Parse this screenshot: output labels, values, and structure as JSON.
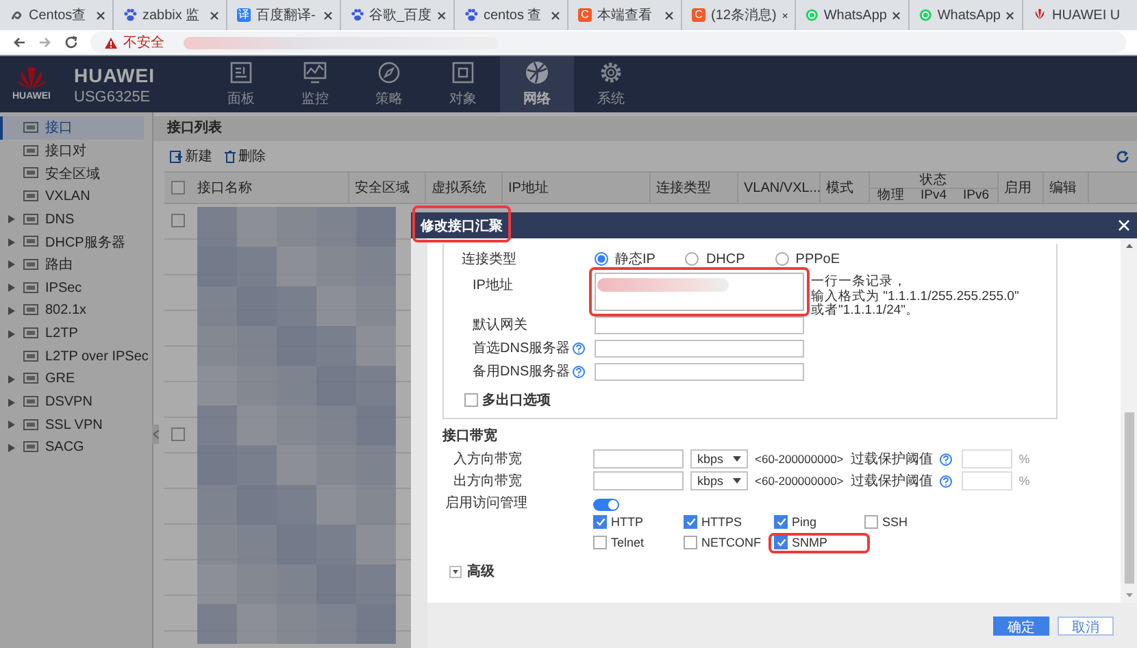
{
  "browser": {
    "tabs": [
      {
        "title": "Centos查",
        "kind": "swirl"
      },
      {
        "title": "zabbix 监",
        "kind": "paw"
      },
      {
        "title": "百度翻译-",
        "kind": "badge",
        "badge": "译",
        "color": "#2f7ef5"
      },
      {
        "title": "谷歌_百度",
        "kind": "paw"
      },
      {
        "title": "centos 查",
        "kind": "paw"
      },
      {
        "title": "本端查看",
        "kind": "badge",
        "badge": "C",
        "color": "#f25a2a"
      },
      {
        "title": "(12条消息)",
        "kind": "badge",
        "badge": "C",
        "color": "#f25a2a"
      },
      {
        "title": "WhatsApp",
        "kind": "whatsapp"
      },
      {
        "title": "WhatsApp",
        "kind": "whatsapp"
      },
      {
        "title": "HUAWEI U",
        "kind": "huawei"
      }
    ],
    "address": {
      "security_label": "不安全",
      "url_redacted": true
    }
  },
  "app": {
    "logo_text": "HUAWEI",
    "brand": "HUAWEI",
    "model": "USG6325E",
    "nav": [
      {
        "label": "面板",
        "kind": "dashboard",
        "selected": false
      },
      {
        "label": "监控",
        "kind": "monitor",
        "selected": false
      },
      {
        "label": "策略",
        "kind": "compass",
        "selected": false
      },
      {
        "label": "对象",
        "kind": "object",
        "selected": false
      },
      {
        "label": "网络",
        "kind": "globe",
        "selected": true
      },
      {
        "label": "系统",
        "kind": "gear",
        "selected": false
      }
    ]
  },
  "sidebar": {
    "items": [
      {
        "label": "接口",
        "selected": true,
        "expandable": false
      },
      {
        "label": "接口对",
        "selected": false,
        "expandable": false
      },
      {
        "label": "安全区域",
        "selected": false,
        "expandable": false
      },
      {
        "label": "VXLAN",
        "selected": false,
        "expandable": false
      },
      {
        "label": "DNS",
        "selected": false,
        "expandable": true
      },
      {
        "label": "DHCP服务器",
        "selected": false,
        "expandable": true
      },
      {
        "label": "路由",
        "selected": false,
        "expandable": true
      },
      {
        "label": "IPSec",
        "selected": false,
        "expandable": true
      },
      {
        "label": "802.1x",
        "selected": false,
        "expandable": true
      },
      {
        "label": "L2TP",
        "selected": false,
        "expandable": true
      },
      {
        "label": "L2TP over IPSec",
        "selected": false,
        "expandable": false
      },
      {
        "label": "GRE",
        "selected": false,
        "expandable": true
      },
      {
        "label": "DSVPN",
        "selected": false,
        "expandable": true
      },
      {
        "label": "SSL VPN",
        "selected": false,
        "expandable": true
      },
      {
        "label": "SACG",
        "selected": false,
        "expandable": true
      }
    ]
  },
  "panel": {
    "title": "接口列表",
    "toolbar": [
      {
        "label": "新建",
        "kind": "new"
      },
      {
        "label": "删除",
        "kind": "delete"
      }
    ],
    "columns": [
      "接口名称",
      "安全区域",
      "虚拟系统",
      "IP地址",
      "连接类型",
      "VLAN/VXL...",
      "模式"
    ],
    "status_column": {
      "label": "状态",
      "subcolumns": [
        "物理",
        "IPv4",
        "IPv6"
      ]
    },
    "trailing_columns": [
      "启用",
      "编辑"
    ],
    "select_all_checked": false,
    "rows": [
      {
        "checked": false
      },
      {
        "checked": false
      }
    ]
  },
  "dialog": {
    "title": "修改接口汇聚",
    "title_highlighted": true,
    "connection": {
      "label": "连接类型",
      "options": [
        {
          "label": "静态IP",
          "selected": true
        },
        {
          "label": "DHCP",
          "selected": false
        },
        {
          "label": "PPPoE",
          "selected": false
        }
      ]
    },
    "ip": {
      "label": "IP地址",
      "value_redacted": true,
      "highlighted": true,
      "hint": [
        "一行一条记录，",
        "输入格式为 \"1.1.1.1/255.255.255.0\"",
        "或者\"1.1.1.1/24\"。"
      ]
    },
    "fields": [
      {
        "label": "默认网关",
        "help": false
      },
      {
        "label": "首选DNS服务器",
        "help": true
      },
      {
        "label": "备用DNS服务器",
        "help": true
      }
    ],
    "multi_exit": {
      "label": "多出口选项",
      "checked": false
    },
    "bandwidth": {
      "title": "接口带宽",
      "rows": [
        {
          "label": "入方向带宽",
          "unit": "kbps",
          "range": "<60-200000000>",
          "threshold_label": "过载保护阈值",
          "percent": "%"
        },
        {
          "label": "出方向带宽",
          "unit": "kbps",
          "range": "<60-200000000>",
          "threshold_label": "过载保护阈值",
          "percent": "%"
        }
      ]
    },
    "access": {
      "label": "启用访问管理",
      "on": true,
      "options": [
        {
          "label": "HTTP",
          "checked": true,
          "highlighted": false
        },
        {
          "label": "HTTPS",
          "checked": true,
          "highlighted": false
        },
        {
          "label": "Ping",
          "checked": true,
          "highlighted": false
        },
        {
          "label": "SSH",
          "checked": false,
          "highlighted": false
        },
        {
          "label": "Telnet",
          "checked": false,
          "highlighted": false
        },
        {
          "label": "NETCONF",
          "checked": false,
          "highlighted": false
        },
        {
          "label": "SNMP",
          "checked": true,
          "highlighted": true
        }
      ]
    },
    "advanced": {
      "label": "高级",
      "expanded": false
    },
    "buttons": [
      {
        "label": "确定",
        "kind": "primary"
      },
      {
        "label": "取消",
        "kind": "secondary"
      }
    ]
  }
}
